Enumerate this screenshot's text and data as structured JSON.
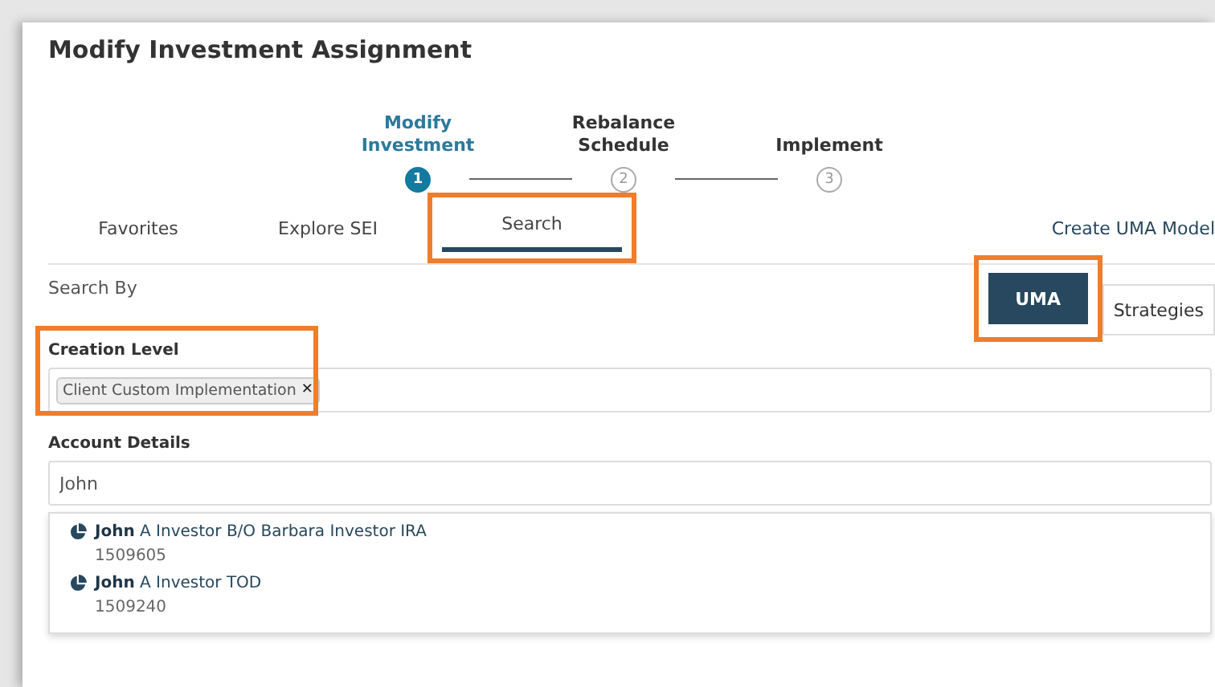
{
  "title": "Modify Investment Assignment",
  "steps": [
    {
      "label": "Modify Investment",
      "number": "1",
      "selected": true
    },
    {
      "label": "Rebalance Schedule",
      "number": "2",
      "selected": false
    },
    {
      "label": "Implement",
      "number": "3",
      "selected": false
    }
  ],
  "tabs": [
    {
      "label": "Favorites",
      "selected": false,
      "highlighted": false
    },
    {
      "label": "Explore SEI",
      "selected": false,
      "highlighted": false
    },
    {
      "label": "Search",
      "selected": true,
      "highlighted": true
    }
  ],
  "create_link": "Create UMA Model",
  "search_by": {
    "label": "Search By",
    "options": [
      {
        "label": "UMA",
        "selected": true,
        "highlighted": true
      },
      {
        "label": "Strategies",
        "selected": false,
        "highlighted": false
      }
    ]
  },
  "creation_level": {
    "label": "Creation Level",
    "highlighted": true,
    "chips": [
      {
        "label": "Client Custom Implementation",
        "remove": "✕"
      }
    ]
  },
  "account_details": {
    "label": "Account Details",
    "value": "John",
    "results": [
      {
        "match": "John",
        "rest": "A Investor B/O Barbara Investor IRA",
        "number": "1509605"
      },
      {
        "match": "John",
        "rest": "A Investor TOD",
        "number": "1509240"
      }
    ]
  }
}
